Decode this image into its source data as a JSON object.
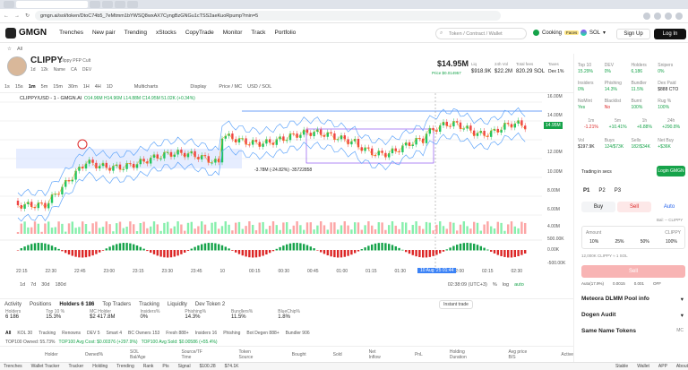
{
  "browser": {
    "url": "gmgn.ai/sol/token/DtoC74b5_7eMtmm1bYWSQ8wxAX7CyngBzGNGu1cTSS2aeKuoRpump?min=5"
  },
  "nav": {
    "logo": "GMGN",
    "items": [
      "Trenches",
      "New pair",
      "Trending",
      "xStocks",
      "CopyTrade",
      "Monitor",
      "Track",
      "Portfolio"
    ],
    "search_placeholder": "Token / Contract / Wallet",
    "cooking": "Cooking",
    "cooking_badge": "Faces",
    "network": "SOL",
    "signup": "Sign Up",
    "login": "Log In"
  },
  "subnav": {
    "all": "All"
  },
  "token": {
    "symbol": "CLIPPY",
    "fullname": "Clippy PFP Cult",
    "age": "1d",
    "holders_hint": "12k",
    "name_label": "Name",
    "ca_label": "CA",
    "dev_label": "DEV",
    "price": "$14.95M",
    "price_sub": "Price $0.014957",
    "liq_label": "Liq",
    "liq": "$918.9K",
    "vol_label": "24h Vol",
    "vol": "$22.2M",
    "supply_label": "Total fees",
    "supply": "820.29 SOL",
    "taxes_label": "Taxes",
    "taxes": "Dex 1%"
  },
  "timeframes": [
    "1s",
    "15s",
    "1m",
    "5m",
    "15m",
    "30m",
    "1H",
    "4H",
    "1D"
  ],
  "chart_toolbar": {
    "multicharts": "Multicharts",
    "display": "Display",
    "pricemc": "Price / MC",
    "usdsol": "USD / SOL"
  },
  "chart": {
    "legend": "CLIPPY/USD - 1 - GMGN.AI",
    "ohlc": "O14.96M H14.96M L14.88M C14.95M 51.02K (+0.34%)",
    "annotation": "-3.78M (-24.82%) -35722858",
    "labels": [
      "3.39",
      "4.66",
      "4.92",
      "5.29"
    ],
    "price_axis": [
      "16.00M",
      "14.00M",
      "12.00M",
      "10.00M",
      "8.00M",
      "6.00M",
      "4.00M"
    ],
    "last_price": "14.95M",
    "vol_axis": [
      "500.00K",
      "0.00K",
      "-500.00K"
    ],
    "time_axis": [
      "22:15",
      "22:30",
      "22:45",
      "23:00",
      "23:15",
      "23:30",
      "23:45",
      "10",
      "00:15",
      "00:30",
      "00:45",
      "01:00",
      "01:15",
      "01:30",
      "01:45",
      "02:00",
      "02:15",
      "02:30"
    ],
    "crosshair_time": "10 Aug '25  01:44"
  },
  "chart_bottom": {
    "ranges": [
      "1d",
      "7d",
      "30d",
      "180d"
    ],
    "clock": "02:38:09 (UTC+3)",
    "pct": "%",
    "log": "log",
    "auto": "auto"
  },
  "activity": {
    "tabs": [
      "Activity",
      "Positions",
      "Holders 6 186",
      "Top Traders",
      "Tracking",
      "Liquidity",
      "Dev Token 2"
    ],
    "instant_trade": "Instant trade"
  },
  "stats": [
    {
      "label": "Holders",
      "value": "6 186"
    },
    {
      "label": "Top 10 %",
      "value": "15.3%"
    },
    {
      "label": "MC Holder",
      "value": "$2 417.8M"
    },
    {
      "label": "Insiders%",
      "value": "0%"
    },
    {
      "label": "Phishing%",
      "value": "14.3%"
    },
    {
      "label": "Bundlers%",
      "value": "11.5%"
    },
    {
      "label": "BlueChip%",
      "value": "1.8%"
    }
  ],
  "filters": [
    "All",
    "KOL 30",
    "Tracking",
    "Renowns",
    "DEV 5",
    "Smart 4",
    "BC Owners 153",
    "Fresh 888+",
    "Insiders 16",
    "Phishing",
    "Bot Degen 888+",
    "Bundler 906"
  ],
  "holders_line": [
    "TOP100 Owned: 55.73%",
    "TOP100 Avg Cost: $0.00376 (+297.9%)",
    "TOP100 Avg Sold: $0.00586 (+55.4%)"
  ],
  "table_headers": [
    "Holder",
    "Owned%",
    "SOL Bal/Age",
    "Source/TF Time",
    "Token Source",
    "Bought",
    "Sold",
    "Net Inflow",
    "PnL",
    "Holding Duration",
    "Avg price B/S",
    "Active"
  ],
  "statusbar": [
    "Trenches",
    "Wallet Tracker",
    "Tracker",
    "Holding",
    "Trending",
    "Rank",
    "Pts",
    "Signal",
    "$100.28",
    "$74.1K",
    "Stable",
    "Wallet",
    "APP",
    "About"
  ],
  "right": {
    "metrics1": [
      {
        "l": "Top 10",
        "v": "15.29%"
      },
      {
        "l": "DEV",
        "v": "0%"
      },
      {
        "l": "Holders",
        "v": "6,186"
      },
      {
        "l": "Snipers",
        "v": "0%"
      }
    ],
    "metrics2": [
      {
        "l": "Insiders",
        "v": "0%"
      },
      {
        "l": "Phishing",
        "v": "14.3%"
      },
      {
        "l": "Bundler",
        "v": "11.5%"
      },
      {
        "l": "Dex Paid",
        "v": "$888 CTO"
      }
    ],
    "metrics3": [
      {
        "l": "NoMint",
        "v": "Yes"
      },
      {
        "l": "Blacklist",
        "v": "No"
      },
      {
        "l": "Burnt",
        "v": "100%"
      },
      {
        "l": "Rug %",
        "v": "100%"
      }
    ],
    "timeframes": [
      {
        "l": "1m",
        "v": "-1.21%"
      },
      {
        "l": "5m",
        "v": "+10.41%"
      },
      {
        "l": "1h",
        "v": "+6.88%"
      },
      {
        "l": "24h",
        "v": "+290.8%"
      }
    ],
    "vol": [
      {
        "l": "Vol",
        "v": "$197.9K"
      },
      {
        "l": "Buys",
        "v": "124/$73K"
      },
      {
        "l": "Sells",
        "v": "182/$34K"
      },
      {
        "l": "Net Buy",
        "v": "+$36K"
      }
    ],
    "trading": "Trading in secs",
    "login": "Login GMGN",
    "presets": [
      "P1",
      "P2",
      "P3"
    ],
    "buy": "Buy",
    "sell": "Sell",
    "auto": "Auto",
    "bal": "Bal: -- CLIPPY",
    "amount": "Amount",
    "amount_unit": "CLIPPY",
    "pcts": [
      "10%",
      "25%",
      "50%",
      "100%"
    ],
    "rate": "12,000K CLIPPY ≈ 1 SOL",
    "sell_btn": "Sell",
    "auto_row": [
      "Auto(17.9%)",
      "0.0015",
      "0.001",
      "OFF"
    ],
    "sections": [
      "Meteora DLMM Pool info",
      "Dogen Audit",
      "Same Name Tokens"
    ],
    "mc": "MC"
  },
  "colors": {
    "accent": "#16a34a",
    "sell": "#ef4444",
    "blue": "#3b82f6"
  }
}
